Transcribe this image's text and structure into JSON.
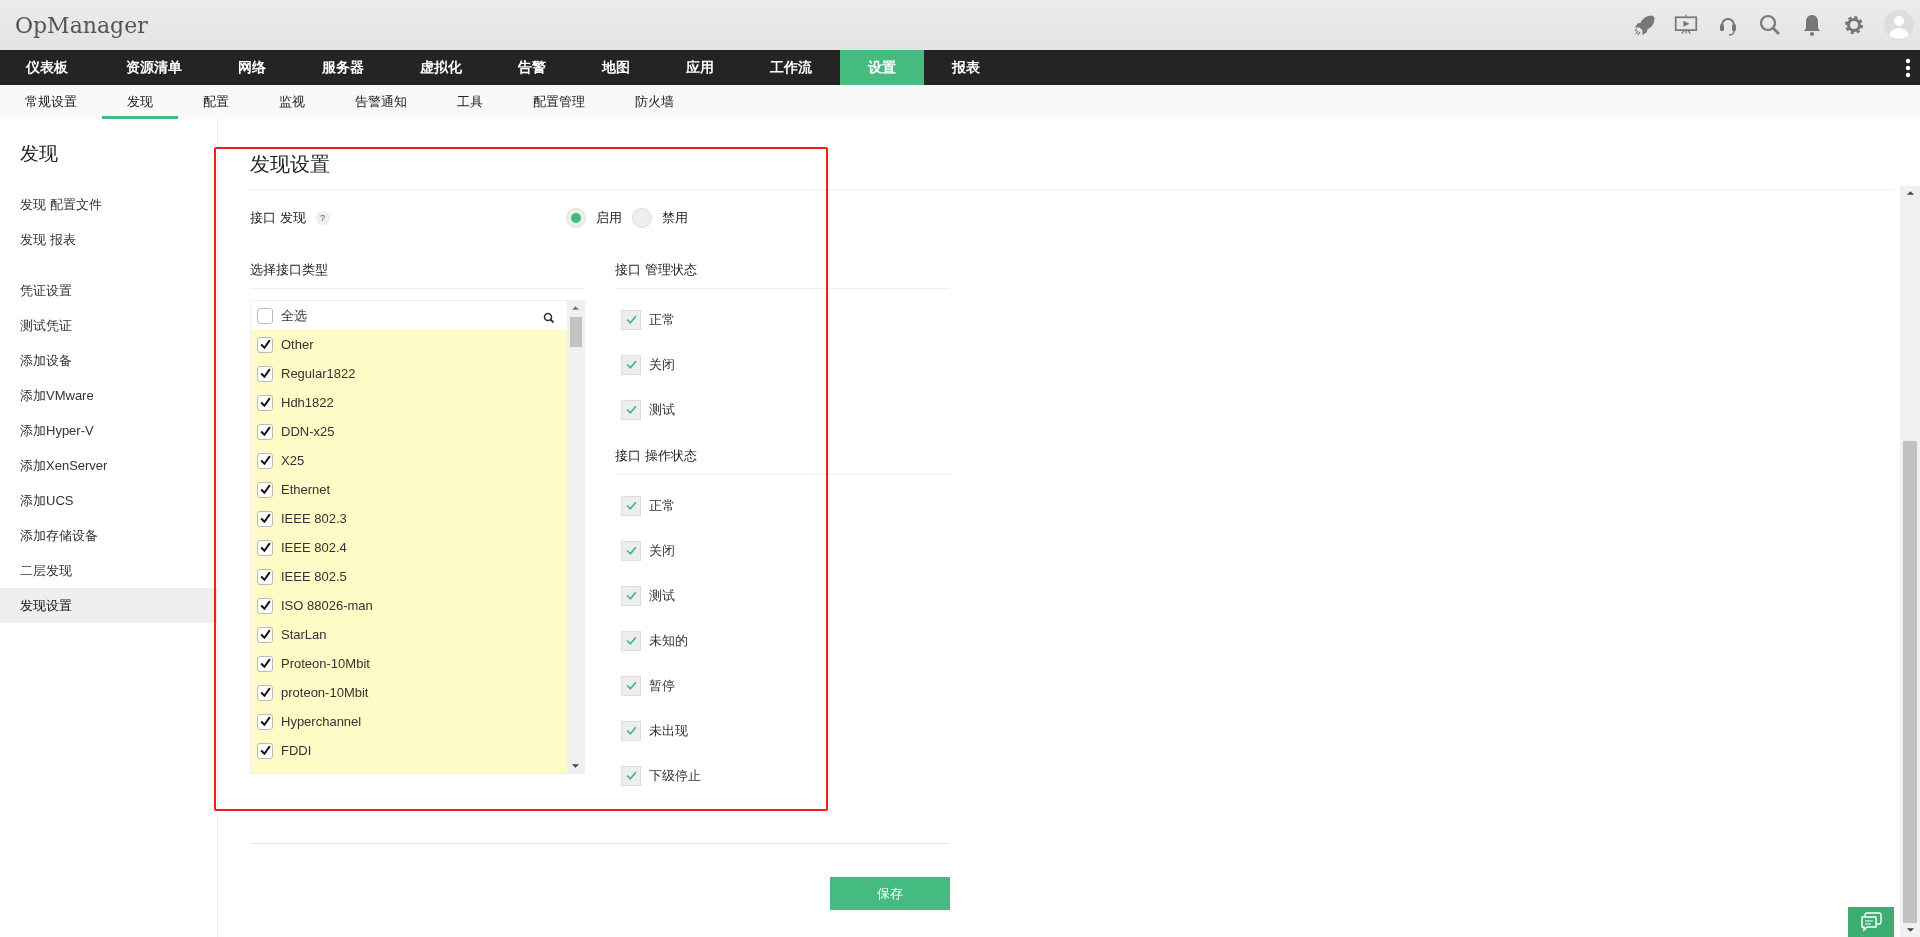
{
  "app": {
    "title": "OpManager"
  },
  "main_nav": [
    {
      "label": "仪表板",
      "selected": false
    },
    {
      "label": "资源清单",
      "selected": false
    },
    {
      "label": "网络",
      "selected": false
    },
    {
      "label": "服务器",
      "selected": false
    },
    {
      "label": "虚拟化",
      "selected": false
    },
    {
      "label": "告警",
      "selected": false
    },
    {
      "label": "地图",
      "selected": false
    },
    {
      "label": "应用",
      "selected": false
    },
    {
      "label": "工作流",
      "selected": false
    },
    {
      "label": "设置",
      "selected": true
    },
    {
      "label": "报表",
      "selected": false
    }
  ],
  "sub_nav": [
    {
      "label": "常规设置",
      "selected": false
    },
    {
      "label": "发现",
      "selected": true
    },
    {
      "label": "配置",
      "selected": false
    },
    {
      "label": "监视",
      "selected": false
    },
    {
      "label": "告警通知",
      "selected": false
    },
    {
      "label": "工具",
      "selected": false
    },
    {
      "label": "配置管理",
      "selected": false
    },
    {
      "label": "防火墙",
      "selected": false
    }
  ],
  "sidebar": {
    "title": "发现",
    "groups": [
      [
        {
          "label": "发现 配置文件",
          "selected": false
        },
        {
          "label": "发现 报表",
          "selected": false
        }
      ],
      [
        {
          "label": "凭证设置",
          "selected": false
        },
        {
          "label": "测试凭证",
          "selected": false
        },
        {
          "label": "添加设备",
          "selected": false
        },
        {
          "label": "添加VMware",
          "selected": false
        },
        {
          "label": "添加Hyper-V",
          "selected": false
        },
        {
          "label": "添加XenServer",
          "selected": false
        },
        {
          "label": "添加UCS",
          "selected": false
        },
        {
          "label": "添加存储设备",
          "selected": false
        },
        {
          "label": "二层发现",
          "selected": false
        },
        {
          "label": "发现设置",
          "selected": true
        }
      ]
    ]
  },
  "form": {
    "title": "发现设置",
    "interface_discovery": {
      "label": "接口 发现",
      "help": "?",
      "options": [
        {
          "label": "启用",
          "selected": true
        },
        {
          "label": "禁用",
          "selected": false
        }
      ]
    },
    "interface_types": {
      "label": "选择接口类型",
      "select_all": {
        "label": "全选",
        "checked": false
      },
      "items": [
        {
          "label": "Other",
          "checked": true
        },
        {
          "label": "Regular1822",
          "checked": true
        },
        {
          "label": "Hdh1822",
          "checked": true
        },
        {
          "label": "DDN-x25",
          "checked": true
        },
        {
          "label": "X25",
          "checked": true
        },
        {
          "label": "Ethernet",
          "checked": true
        },
        {
          "label": "IEEE 802.3",
          "checked": true
        },
        {
          "label": "IEEE 802.4",
          "checked": true
        },
        {
          "label": "IEEE 802.5",
          "checked": true
        },
        {
          "label": "ISO 88026-man",
          "checked": true
        },
        {
          "label": "StarLan",
          "checked": true
        },
        {
          "label": "Proteon-10Mbit",
          "checked": true
        },
        {
          "label": "proteon-10Mbit",
          "checked": true
        },
        {
          "label": "Hyperchannel",
          "checked": true
        },
        {
          "label": "FDDI",
          "checked": true
        }
      ]
    },
    "admin_status": {
      "label": "接口 管理状态",
      "items": [
        {
          "label": "正常",
          "checked": true
        },
        {
          "label": "关闭",
          "checked": true
        },
        {
          "label": "测试",
          "checked": true
        }
      ]
    },
    "oper_status": {
      "label": "接口 操作状态",
      "items": [
        {
          "label": "正常",
          "checked": true
        },
        {
          "label": "关闭",
          "checked": true
        },
        {
          "label": "测试",
          "checked": true
        },
        {
          "label": "未知的",
          "checked": true
        },
        {
          "label": "暂停",
          "checked": true
        },
        {
          "label": "未出现",
          "checked": true
        },
        {
          "label": "下级停止",
          "checked": true
        }
      ]
    },
    "save_button": "保存"
  }
}
